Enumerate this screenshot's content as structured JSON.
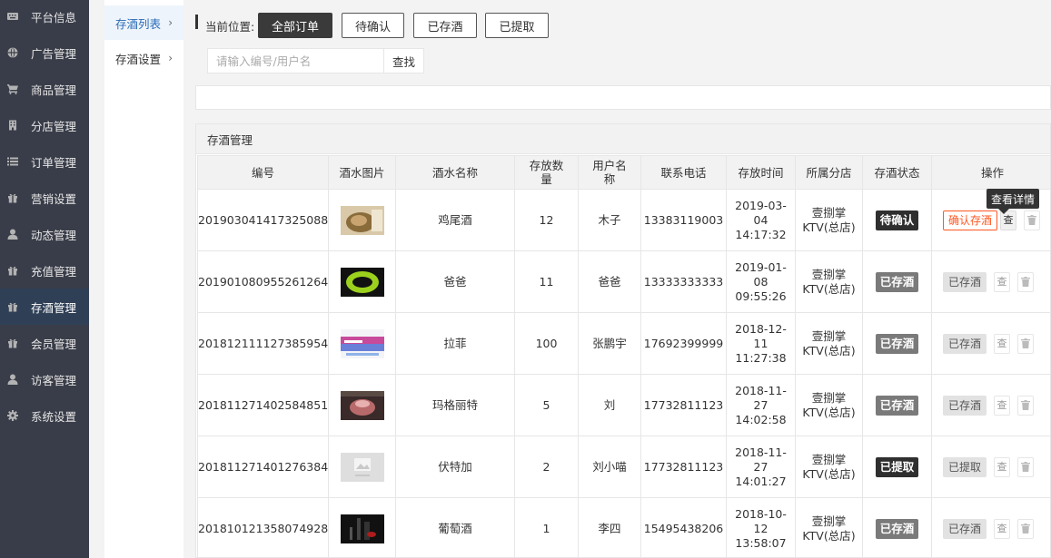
{
  "sidebar": {
    "items": [
      {
        "label": "平台信息",
        "icon": "keyboard-icon"
      },
      {
        "label": "广告管理",
        "icon": "globe-icon"
      },
      {
        "label": "商品管理",
        "icon": "cart-icon"
      },
      {
        "label": "分店管理",
        "icon": "building-icon"
      },
      {
        "label": "订单管理",
        "icon": "list-icon"
      },
      {
        "label": "营销设置",
        "icon": "gift-icon"
      },
      {
        "label": "动态管理",
        "icon": "user-icon"
      },
      {
        "label": "充值管理",
        "icon": "gift-icon"
      },
      {
        "label": "存酒管理",
        "icon": "gift-icon"
      },
      {
        "label": "会员管理",
        "icon": "gift-icon"
      },
      {
        "label": "访客管理",
        "icon": "user-icon"
      },
      {
        "label": "系统设置",
        "icon": "gear-icon"
      }
    ]
  },
  "subnav": {
    "items": [
      {
        "label": "存酒列表"
      },
      {
        "label": "存酒设置"
      }
    ]
  },
  "filters": {
    "breadcrumb_label": "当前位置:",
    "buttons": [
      "全部订单",
      "待确认",
      "已存酒",
      "已提取"
    ]
  },
  "search": {
    "placeholder": "请输入编号/用户名",
    "button_label": "查找"
  },
  "panel": {
    "title": "存酒管理"
  },
  "table": {
    "headers": [
      "编号",
      "酒水图片",
      "酒水名称",
      "存放数量",
      "用户名称",
      "联系电话",
      "存放时间",
      "所属分店",
      "存酒状态",
      "操作"
    ],
    "rows": [
      {
        "id": "201903041417325088",
        "image": "cocktail-photo",
        "name": "鸡尾酒",
        "qty": "12",
        "user": "木子",
        "phone": "13383119003",
        "time_date": "2019-03-",
        "time_day": "04",
        "time_clock": "14:17:32",
        "branch_1": "壹捌掌",
        "branch_2": "KTV(总店)",
        "status": "待确认",
        "status_type": "pending",
        "action": "确认存酒",
        "action_type": "confirm"
      },
      {
        "id": "201901080955261264",
        "image": "green-ring-photo",
        "name": "爸爸",
        "qty": "11",
        "user": "爸爸",
        "phone": "13333333333",
        "time_date": "2019-01-",
        "time_day": "08",
        "time_clock": "09:55:26",
        "branch_1": "壹捌掌",
        "branch_2": "KTV(总店)",
        "status": "已存酒",
        "status_type": "done",
        "action": "已存酒",
        "action_type": "gray"
      },
      {
        "id": "201812111127385954",
        "image": "banner-photo",
        "name": "拉菲",
        "qty": "100",
        "user": "张鹏宇",
        "phone": "17692399999",
        "time_date": "2018-12-",
        "time_day": "11",
        "time_clock": "11:27:38",
        "branch_1": "壹捌掌",
        "branch_2": "KTV(总店)",
        "status": "已存酒",
        "status_type": "done",
        "action": "已存酒",
        "action_type": "gray"
      },
      {
        "id": "201811271402584851",
        "image": "wine-glass-photo",
        "name": "玛格丽特",
        "qty": "5",
        "user": "刘",
        "phone": "17732811123",
        "time_date": "2018-11-",
        "time_day": "27",
        "time_clock": "14:02:58",
        "branch_1": "壹捌掌",
        "branch_2": "KTV(总店)",
        "status": "已存酒",
        "status_type": "done",
        "action": "已存酒",
        "action_type": "gray"
      },
      {
        "id": "201811271401276384",
        "image": "placeholder-photo",
        "name": "伏特加",
        "qty": "2",
        "user": "刘小喵",
        "phone": "17732811123",
        "time_date": "2018-11-",
        "time_day": "27",
        "time_clock": "14:01:27",
        "branch_1": "壹捌掌",
        "branch_2": "KTV(总店)",
        "status": "已提取",
        "status_type": "pending",
        "action": "已提取",
        "action_type": "gray"
      },
      {
        "id": "201810121358074928",
        "image": "bottle-photo",
        "name": "葡萄酒",
        "qty": "1",
        "user": "李四",
        "phone": "15495438206",
        "time_date": "2018-10-",
        "time_day": "12",
        "time_clock": "13:58:07",
        "branch_1": "壹捌掌",
        "branch_2": "KTV(总店)",
        "status": "已存酒",
        "status_type": "done",
        "action": "已存酒",
        "action_type": "gray"
      }
    ],
    "view_label": "查",
    "tooltip": "查看详情"
  },
  "colors": {
    "sidebar_bg": "#393d49",
    "sidebar_active": "#2f4056",
    "confirm_orange": "#ff5722",
    "pending_badge": "#2f2f2f",
    "done_badge": "#7a7a7a"
  }
}
